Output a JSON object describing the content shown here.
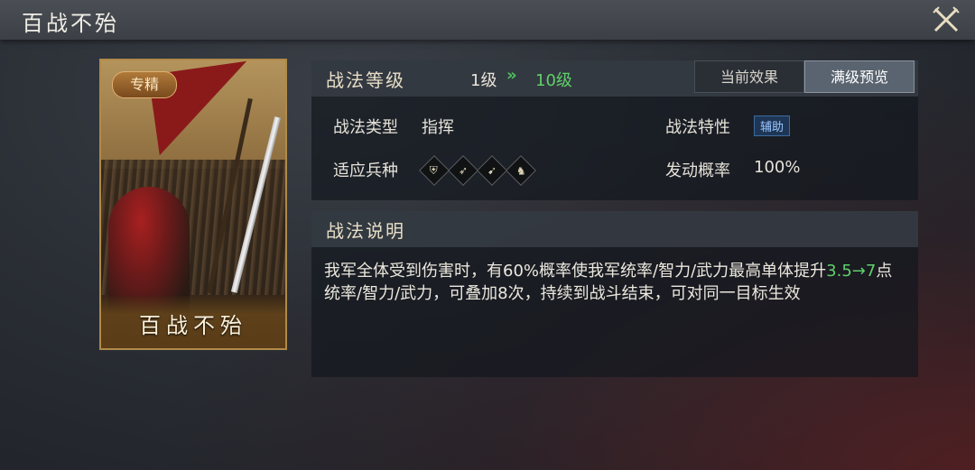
{
  "window": {
    "title": "百战不殆",
    "close_icon": "crossed-swords-close-icon"
  },
  "card": {
    "badge": "专精",
    "name": "百战不殆"
  },
  "level": {
    "label": "战法等级",
    "current": "1级",
    "arrow": "»",
    "max": "10级",
    "tabs": [
      {
        "label": "当前效果",
        "active": false
      },
      {
        "label": "满级预览",
        "active": true
      }
    ]
  },
  "info": {
    "type_key": "战法类型",
    "type_value": "指挥",
    "trait_key": "战法特性",
    "trait_value": "辅助",
    "troops_key": "适应兵种",
    "troops": [
      "shield-icon",
      "bow-icon",
      "spear-icon",
      "horse-icon"
    ],
    "rate_key": "发动概率",
    "rate_value": "100%"
  },
  "description": {
    "label": "战法说明",
    "text_before": "我军全体受到伤害时，有60%概率使我军统率/智力/武力最高单体提升",
    "highlight": "3.5→7",
    "text_after": "点统率/智力/武力，可叠加8次，持续到战斗结束，可对同一目标生效"
  },
  "colors": {
    "accent_green": "#5fd06a",
    "tag_blue": "#9cc6ff",
    "card_border": "#b08a48"
  }
}
